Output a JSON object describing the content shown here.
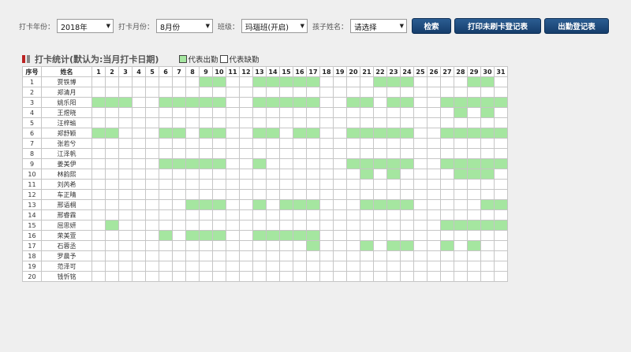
{
  "toolbar": {
    "year_label": "打卡年份：",
    "year_value": "2018年",
    "month_label": "打卡月份：",
    "month_value": "8月份",
    "class_label": "班级：",
    "class_value": "玛瑙班(开启)",
    "child_label": "孩子姓名：",
    "child_value": "请选择",
    "search_btn": "检索",
    "print_unswiped_btn": "打印未刷卡登记表",
    "attendance_btn": "出勤登记表"
  },
  "section": {
    "title": "打卡统计(默认为:当月打卡日期)",
    "legend_present": "代表出勤",
    "legend_absent": "代表缺勤",
    "present_color": "#a5e6a0"
  },
  "table": {
    "col_seq": "序号",
    "col_name": "姓名",
    "days": [
      "1",
      "2",
      "3",
      "4",
      "5",
      "6",
      "7",
      "8",
      "9",
      "10",
      "11",
      "12",
      "13",
      "14",
      "15",
      "16",
      "17",
      "18",
      "19",
      "20",
      "21",
      "22",
      "23",
      "24",
      "25",
      "26",
      "27",
      "28",
      "29",
      "30",
      "31"
    ],
    "rows": [
      {
        "seq": "1",
        "name": "贾铁博",
        "present": [
          9,
          10,
          13,
          14,
          15,
          16,
          17,
          22,
          23,
          24,
          29,
          30
        ]
      },
      {
        "seq": "2",
        "name": "郑清月",
        "present": []
      },
      {
        "seq": "3",
        "name": "姚乐阳",
        "present": [
          1,
          2,
          3,
          6,
          7,
          8,
          9,
          10,
          13,
          14,
          15,
          16,
          17,
          20,
          21,
          23,
          24,
          27,
          28,
          29,
          30,
          31
        ]
      },
      {
        "seq": "4",
        "name": "王煜晓",
        "present": [
          28,
          30
        ]
      },
      {
        "seq": "5",
        "name": "汪梓瑜",
        "present": []
      },
      {
        "seq": "6",
        "name": "郑舒颖",
        "present": [
          1,
          2,
          6,
          7,
          9,
          10,
          13,
          14,
          16,
          17,
          20,
          21,
          22,
          23,
          24,
          27,
          28,
          29,
          30,
          31
        ]
      },
      {
        "seq": "7",
        "name": "张若兮",
        "present": []
      },
      {
        "seq": "8",
        "name": "江泽帆",
        "present": []
      },
      {
        "seq": "9",
        "name": "姜美伊",
        "present": [
          6,
          7,
          8,
          9,
          10,
          13,
          20,
          21,
          22,
          23,
          24,
          27,
          28,
          29,
          30,
          31
        ]
      },
      {
        "seq": "10",
        "name": "林韵熙",
        "present": [
          21,
          23,
          28,
          29,
          30
        ]
      },
      {
        "seq": "11",
        "name": "刘芮希",
        "present": []
      },
      {
        "seq": "12",
        "name": "车正晴",
        "present": []
      },
      {
        "seq": "13",
        "name": "邢语桐",
        "present": [
          8,
          9,
          10,
          13,
          15,
          16,
          17,
          21,
          22,
          23,
          24,
          30,
          31
        ]
      },
      {
        "seq": "14",
        "name": "邢睿霖",
        "present": []
      },
      {
        "seq": "15",
        "name": "屈思妍",
        "present": [
          2,
          27,
          28,
          29,
          30,
          31
        ]
      },
      {
        "seq": "16",
        "name": "荣美萱",
        "present": [
          6,
          8,
          9,
          10,
          13,
          14,
          15,
          16,
          17
        ]
      },
      {
        "seq": "17",
        "name": "石蓉丞",
        "present": [
          17,
          21,
          23,
          24,
          27,
          29
        ]
      },
      {
        "seq": "18",
        "name": "罗晨予",
        "present": []
      },
      {
        "seq": "19",
        "name": "范泽可",
        "present": []
      },
      {
        "seq": "20",
        "name": "钱忻铭",
        "present": []
      }
    ]
  }
}
